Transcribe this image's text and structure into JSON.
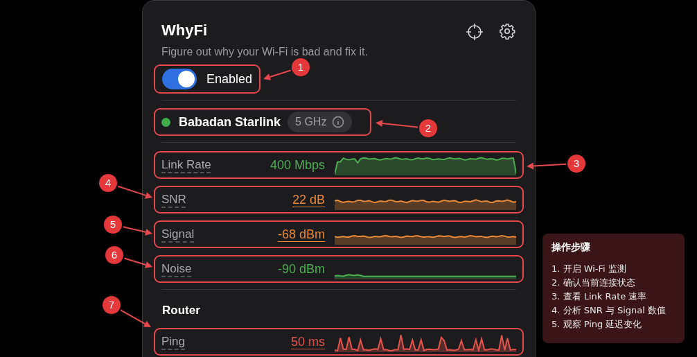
{
  "app": {
    "title": "WhyFi",
    "subtitle": "Figure out why your Wi-Fi is bad and fix it."
  },
  "toggle": {
    "label": "Enabled",
    "on": true
  },
  "network": {
    "name": "Babadan Starlink",
    "color": "#3fae4a",
    "band": "5 GHz"
  },
  "metrics": [
    {
      "label": "Link Rate",
      "value": "400 Mbps",
      "color": "#4caf50",
      "underlined": false
    },
    {
      "label": "SNR",
      "value": "22 dB",
      "color": "#e8893a",
      "underlined": true
    },
    {
      "label": "Signal",
      "value": "-68 dBm",
      "color": "#e8893a",
      "underlined": true
    },
    {
      "label": "Noise",
      "value": "-90 dBm",
      "color": "#4caf50",
      "underlined": false
    }
  ],
  "router": {
    "heading": "Router",
    "metrics": [
      {
        "label": "Ping",
        "value": "50 ms",
        "color": "#e5534b",
        "underlined": true
      }
    ]
  },
  "annotations": [
    {
      "number": "1"
    },
    {
      "number": "2"
    },
    {
      "number": "3"
    },
    {
      "number": "4"
    },
    {
      "number": "5"
    },
    {
      "number": "6"
    },
    {
      "number": "7"
    }
  ],
  "steps_panel": {
    "title": "操作步骤",
    "steps": [
      "1. 开启 Wi-Fi 监测",
      "2. 确认当前连接状态",
      "3. 查看 Link Rate 速率",
      "4. 分析 SNR 与 Signal 数值",
      "5. 观察 Ping 延迟变化"
    ]
  }
}
